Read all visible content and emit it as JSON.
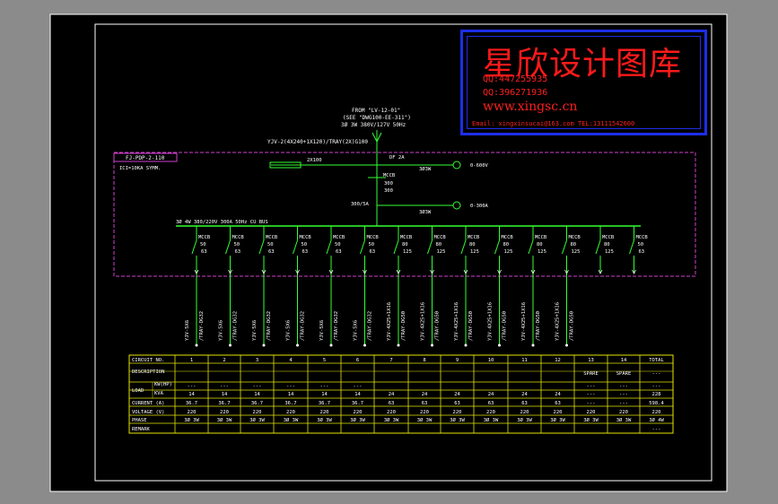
{
  "stamp": {
    "title": "星欣设计图库",
    "qq1": "QQ:447255935",
    "qq2": "QQ:396271936",
    "website": "www.xingsc.cn",
    "contact": "Email: xingxinsucai@163.com  TEL:13111542600"
  },
  "source": {
    "from": "FROM \"LV-12-01\"",
    "see": "(SEE \"DWG100-EE-311\")",
    "supply": "3Ø 3W 380V/127V 50Hz",
    "cable": "YJV-2(4X240+1X120)/TRAY(2X)G100"
  },
  "panel": {
    "name": "FJ-PDP-2-110",
    "rating": "ICI=10KA SYMM.",
    "busbar": "3Ø 4W 380/220V 300A 50Hz CU BUS",
    "meter_top": "2X100",
    "df_label": "DF 2A",
    "mccb_main": "MCCB",
    "mccb_main_rating": "300",
    "mccb_main_setting": "300",
    "ct_label": "300/5A",
    "meter_3w_a": "3Ø3W",
    "meter_3w_b": "3Ø3W",
    "voltmeter": "0-600V",
    "ammeter": "0-300A"
  },
  "breakers": [
    {
      "type": "MCCB",
      "trip": "50",
      "frame": "63",
      "cable": "YJV-5X6",
      "route": "/TRAY-DG32"
    },
    {
      "type": "MCCB",
      "trip": "50",
      "frame": "63",
      "cable": "YJV-5X6",
      "route": "/TRAY-DG32"
    },
    {
      "type": "MCCB",
      "trip": "50",
      "frame": "63",
      "cable": "YJV-5X6",
      "route": "/TRAY-DG32"
    },
    {
      "type": "MCCB",
      "trip": "50",
      "frame": "63",
      "cable": "YJV-5X6",
      "route": "/TRAY-DG32"
    },
    {
      "type": "MCCB",
      "trip": "50",
      "frame": "63",
      "cable": "YJV-5X6",
      "route": "/TRAY-DG32"
    },
    {
      "type": "MCCB",
      "trip": "50",
      "frame": "63",
      "cable": "YJV-5X6",
      "route": "/TRAY-DG32"
    },
    {
      "type": "MCCB",
      "trip": "80",
      "frame": "125",
      "cable": "YJV-4X25+1X16",
      "route": "/TRAY-DG50"
    },
    {
      "type": "MCCB",
      "trip": "80",
      "frame": "125",
      "cable": "YJV-4X25+1X16",
      "route": "/TRAY-DG50"
    },
    {
      "type": "MCCB",
      "trip": "80",
      "frame": "125",
      "cable": "YJV-4X25+1X16",
      "route": "/TRAY-DG50"
    },
    {
      "type": "MCCB",
      "trip": "80",
      "frame": "125",
      "cable": "YJV-4X25+1X16",
      "route": "/TRAY-DG50"
    },
    {
      "type": "MCCB",
      "trip": "80",
      "frame": "125",
      "cable": "YJV-4X25+1X16",
      "route": "/TRAY-DG50"
    },
    {
      "type": "MCCB",
      "trip": "80",
      "frame": "125",
      "cable": "YJV-4X25+1X16",
      "route": "/TRAY-DG50"
    },
    {
      "type": "MCCB",
      "trip": "80",
      "frame": "125",
      "cable": "",
      "route": ""
    },
    {
      "type": "MCCB",
      "trip": "50",
      "frame": "63",
      "cable": "",
      "route": ""
    }
  ],
  "table": {
    "row_labels": [
      "CIRCUIT NO.",
      "DESCRIPTION",
      "KW(HP)",
      "KVA",
      "CURRENT (A)",
      "VOLTAGE (V)",
      "PHASE",
      "REMARK"
    ],
    "load_label": "LOAD",
    "columns": [
      {
        "no": "1",
        "desc": "",
        "kw": "---",
        "kva": "14",
        "current": "36.7",
        "voltage": "220",
        "phase": "3Ø 3W"
      },
      {
        "no": "2",
        "desc": "",
        "kw": "---",
        "kva": "14",
        "current": "36.7",
        "voltage": "220",
        "phase": "3Ø 3W"
      },
      {
        "no": "3",
        "desc": "",
        "kw": "---",
        "kva": "14",
        "current": "36.7",
        "voltage": "220",
        "phase": "3Ø 3W"
      },
      {
        "no": "4",
        "desc": "",
        "kw": "---",
        "kva": "14",
        "current": "36.7",
        "voltage": "220",
        "phase": "3Ø 3W"
      },
      {
        "no": "5",
        "desc": "",
        "kw": "---",
        "kva": "14",
        "current": "36.7",
        "voltage": "220",
        "phase": "3Ø 3W"
      },
      {
        "no": "6",
        "desc": "",
        "kw": "---",
        "kva": "14",
        "current": "36.7",
        "voltage": "220",
        "phase": "3Ø 3W"
      },
      {
        "no": "7",
        "desc": "",
        "kw": "",
        "kva": "24",
        "current": "63",
        "voltage": "220",
        "phase": "3Ø 3W"
      },
      {
        "no": "8",
        "desc": "",
        "kw": "",
        "kva": "24",
        "current": "63",
        "voltage": "220",
        "phase": "3Ø 3W"
      },
      {
        "no": "9",
        "desc": "",
        "kw": "",
        "kva": "24",
        "current": "63",
        "voltage": "220",
        "phase": "3Ø 3W"
      },
      {
        "no": "10",
        "desc": "",
        "kw": "",
        "kva": "24",
        "current": "63",
        "voltage": "220",
        "phase": "3Ø 3W"
      },
      {
        "no": "11",
        "desc": "",
        "kw": "",
        "kva": "24",
        "current": "63",
        "voltage": "220",
        "phase": "3Ø 3W"
      },
      {
        "no": "12",
        "desc": "",
        "kw": "",
        "kva": "24",
        "current": "63",
        "voltage": "220",
        "phase": "3Ø 3W"
      },
      {
        "no": "13",
        "desc": "SPARE",
        "kw": "---",
        "kva": "---",
        "current": "---",
        "voltage": "220",
        "phase": "3Ø 3W"
      },
      {
        "no": "14",
        "desc": "SPARE",
        "kw": "---",
        "kva": "---",
        "current": "---",
        "voltage": "220",
        "phase": "3Ø 3W"
      },
      {
        "no": "TOTAL",
        "desc": "---",
        "kw": "---",
        "kva": "228",
        "current": "598.4",
        "voltage": "220",
        "phase": "3Ø 4W",
        "remark": "---"
      }
    ]
  }
}
